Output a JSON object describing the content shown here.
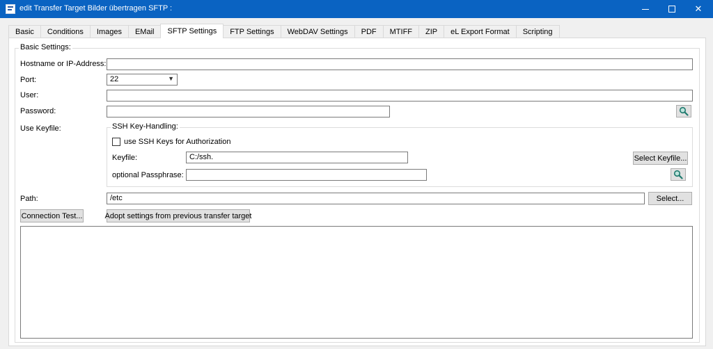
{
  "window": {
    "title": "edit Transfer Target Bilder übertragen SFTP :",
    "minimize_glyph": "—",
    "maximize_glyph": "☐",
    "close_glyph": "✕"
  },
  "tabs": [
    {
      "label": "Basic"
    },
    {
      "label": "Conditions"
    },
    {
      "label": "Images"
    },
    {
      "label": "EMail"
    },
    {
      "label": "SFTP Settings",
      "active": true
    },
    {
      "label": "FTP Settings"
    },
    {
      "label": "WebDAV Settings"
    },
    {
      "label": "PDF"
    },
    {
      "label": "MTIFF"
    },
    {
      "label": "ZIP"
    },
    {
      "label": "eL Export Format"
    },
    {
      "label": "Scripting"
    }
  ],
  "basic_settings": {
    "group_label": "Basic Settings:",
    "hostname_label": "Hostname or IP-Address:",
    "hostname_value": "",
    "port_label": "Port:",
    "port_value": "22",
    "user_label": "User:",
    "user_value": "",
    "password_label": "Password:",
    "password_value": "",
    "keyfile_label": "Use Keyfile:"
  },
  "ssh": {
    "group_label": "SSH Key-Handling:",
    "use_keys_label": "use SSH Keys for Authorization",
    "use_keys_checked": false,
    "keyfile_label": "Keyfile:",
    "keyfile_value": "C:/ssh.",
    "select_keyfile_button": "Select Keyfile...",
    "passphrase_label": "optional Passphrase:",
    "passphrase_value": ""
  },
  "path": {
    "label": "Path:",
    "value": "/etc",
    "select_button": "Select..."
  },
  "buttons": {
    "connection_test": "Connection Test...",
    "adopt_settings": "Adopt settings from previous transfer target"
  },
  "colors": {
    "titlebar": "#0a63c2",
    "search_icon": "#1f7a6e"
  },
  "icons": {
    "password_show": "search-icon",
    "passphrase_show": "search-icon"
  }
}
